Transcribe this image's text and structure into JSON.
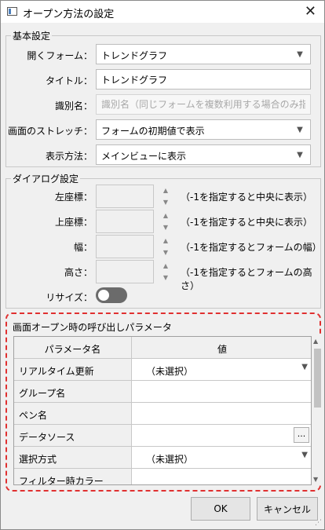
{
  "window": {
    "title": "オープン方法の設定",
    "close_glyph": "✕",
    "app_icon": "window-icon"
  },
  "basic": {
    "legend": "基本設定",
    "open_form": {
      "label": "開くフォーム：",
      "value": "トレンドグラフ"
    },
    "title": {
      "label": "タイトル：",
      "value": "トレンドグラフ"
    },
    "identifier": {
      "label": "識別名：",
      "value": "",
      "placeholder": "識別名（同じフォームを複数利用する場合のみ指定）"
    },
    "stretch": {
      "label": "画面のストレッチ：",
      "value": "フォームの初期値で表示"
    },
    "display": {
      "label": "表示方法：",
      "value": "メインビューに表示"
    }
  },
  "dialog": {
    "legend": "ダイアログ設定",
    "left": {
      "label": "左座標：",
      "value": "",
      "hint": "（-1を指定すると中央に表示）"
    },
    "top": {
      "label": "上座標：",
      "value": "",
      "hint": "（-1を指定すると中央に表示）"
    },
    "width": {
      "label": "幅：",
      "value": "",
      "hint": "（-1を指定するとフォームの幅）"
    },
    "height": {
      "label": "高さ：",
      "value": "",
      "hint": "（-1を指定するとフォームの高さ）"
    },
    "resize": {
      "label": "リサイズ：",
      "state": "off"
    }
  },
  "params": {
    "title": "画面オープン時の呼び出しパラメータ",
    "header": {
      "name": "パラメータ名",
      "value": "値"
    },
    "rows": [
      {
        "name": "リアルタイム更新",
        "value": "（未選択）",
        "kind": "combo"
      },
      {
        "name": "グループ名",
        "value": "",
        "kind": "text"
      },
      {
        "name": "ペン名",
        "value": "",
        "kind": "text"
      },
      {
        "name": "データソース",
        "value": "",
        "kind": "ellipsis",
        "button": "..."
      },
      {
        "name": "選択方式",
        "value": "（未選択）",
        "kind": "combo"
      },
      {
        "name": "フィルター時カラー",
        "value": "",
        "kind": "text"
      }
    ]
  },
  "buttons": {
    "ok": "OK",
    "cancel": "キャンセル"
  },
  "colors": {
    "highlight_border": "#e03030",
    "toggle_off": "#6b6b6b"
  }
}
